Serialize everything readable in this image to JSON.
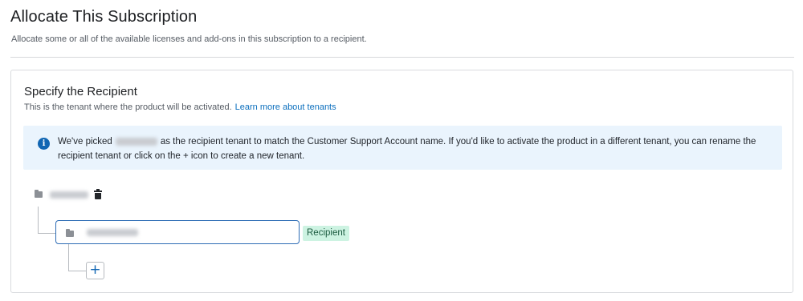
{
  "header": {
    "title": "Allocate This Subscription",
    "subtitle": "Allocate some or all of the available licenses and add-ons in this subscription to a recipient."
  },
  "recipient_section": {
    "title": "Specify the Recipient",
    "description": "This is the tenant where the product will be activated.",
    "learn_more_link": "Learn more about tenants"
  },
  "info_banner": {
    "icon": "info-icon",
    "text_before": "We've picked",
    "text_after": "as the recipient tenant to match the Customer Support Account name. If you'd like to activate the product in a different tenant, you can rename the recipient tenant or click on the + icon to create a new tenant."
  },
  "tree": {
    "root_icon": "folder-icon",
    "delete_icon": "trash-icon",
    "recipient_badge": "Recipient",
    "add_icon_glyph": "+"
  },
  "colors": {
    "accent": "#1166b3",
    "banner_bg": "#eaf4fd",
    "badge_bg": "#cdf3e2",
    "input_border": "#2d6cb5"
  }
}
